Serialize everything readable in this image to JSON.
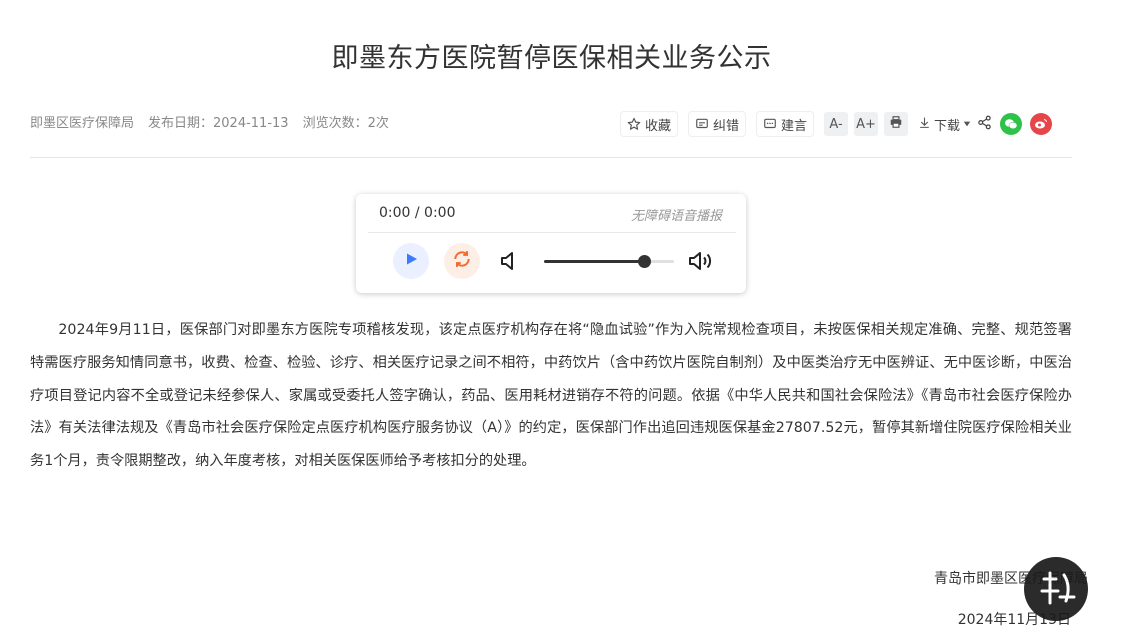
{
  "article": {
    "title": "即墨东方医院暂停医保相关业务公示",
    "source": "即墨区医疗保障局",
    "publish_date_label": "发布日期：2024-11-13",
    "views_label": "浏览次数：2次",
    "body": "2024年9月11日，医保部门对即墨东方医院专项稽核发现，该定点医疗机构存在将“隐血试验”作为入院常规检查项目，未按医保相关规定准确、完整、规范签署特需医疗服务知情同意书，收费、检查、检验、诊疗、相关医疗记录之间不相符，中药饮片（含中药饮片医院自制剂）及中医类治疗无中医辨证、无中医诊断，中医治疗项目登记内容不全或登记未经参保人、家属或受委托人签字确认，药品、医用耗材进销存不符的问题。依据《中华人民共和国社会保险法》《青岛市社会医疗保险办法》有关法律法规及《青岛市社会医疗保险定点医疗机构医疗服务协议（A）》的约定，医保部门作出追回违规医保基金27807.52元，暂停其新增住院医疗保险相关业务1个月，责令限期整改，纳入年度考核，对相关医保医师给予考核扣分的处理。",
    "signature_org": "青岛市即墨区医疗保障局",
    "signature_date": "2024年11月13日"
  },
  "toolbar": {
    "favorite_label": "收藏",
    "correction_label": "纠错",
    "suggestion_label": "建言",
    "font_decrease_label": "A-",
    "font_increase_label": "A+",
    "download_label": "下载"
  },
  "player": {
    "time": "0:00 / 0:00",
    "label": "无障碍语音播报",
    "volume": 0.77
  },
  "colors": {
    "wechat": "#2fc24b",
    "weibo": "#e6454a",
    "play_accent": "#3b7bff",
    "loop_accent": "#f26a2e"
  }
}
